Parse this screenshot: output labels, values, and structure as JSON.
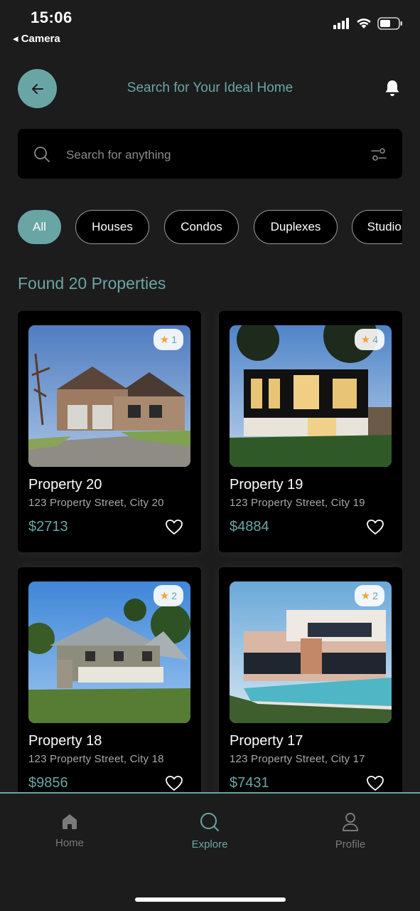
{
  "status": {
    "time": "15:06",
    "back_app": "◂ Camera"
  },
  "header": {
    "title": "Search for Your Ideal Home"
  },
  "search": {
    "placeholder": "Search for anything"
  },
  "categories": [
    "All",
    "Houses",
    "Condos",
    "Duplexes",
    "Studios"
  ],
  "results": {
    "label": "Found 20 Properties"
  },
  "properties": [
    {
      "name": "Property 20",
      "address": "123 Property Street, City 20",
      "price": "$2713",
      "rating": "1"
    },
    {
      "name": "Property 19",
      "address": "123 Property Street, City 19",
      "price": "$4884",
      "rating": "4"
    },
    {
      "name": "Property 18",
      "address": "123 Property Street, City 18",
      "price": "$9856",
      "rating": "2"
    },
    {
      "name": "Property 17",
      "address": "123 Property Street, City 17",
      "price": "$7431",
      "rating": "2"
    }
  ],
  "tabs": [
    {
      "label": "Home",
      "icon": "home-icon"
    },
    {
      "label": "Explore",
      "icon": "search-icon"
    },
    {
      "label": "Profile",
      "icon": "profile-icon"
    }
  ],
  "colors": {
    "accent": "#6aa5a5",
    "background": "#1c1c1c",
    "card": "#000000",
    "star": "#f2a33a"
  }
}
